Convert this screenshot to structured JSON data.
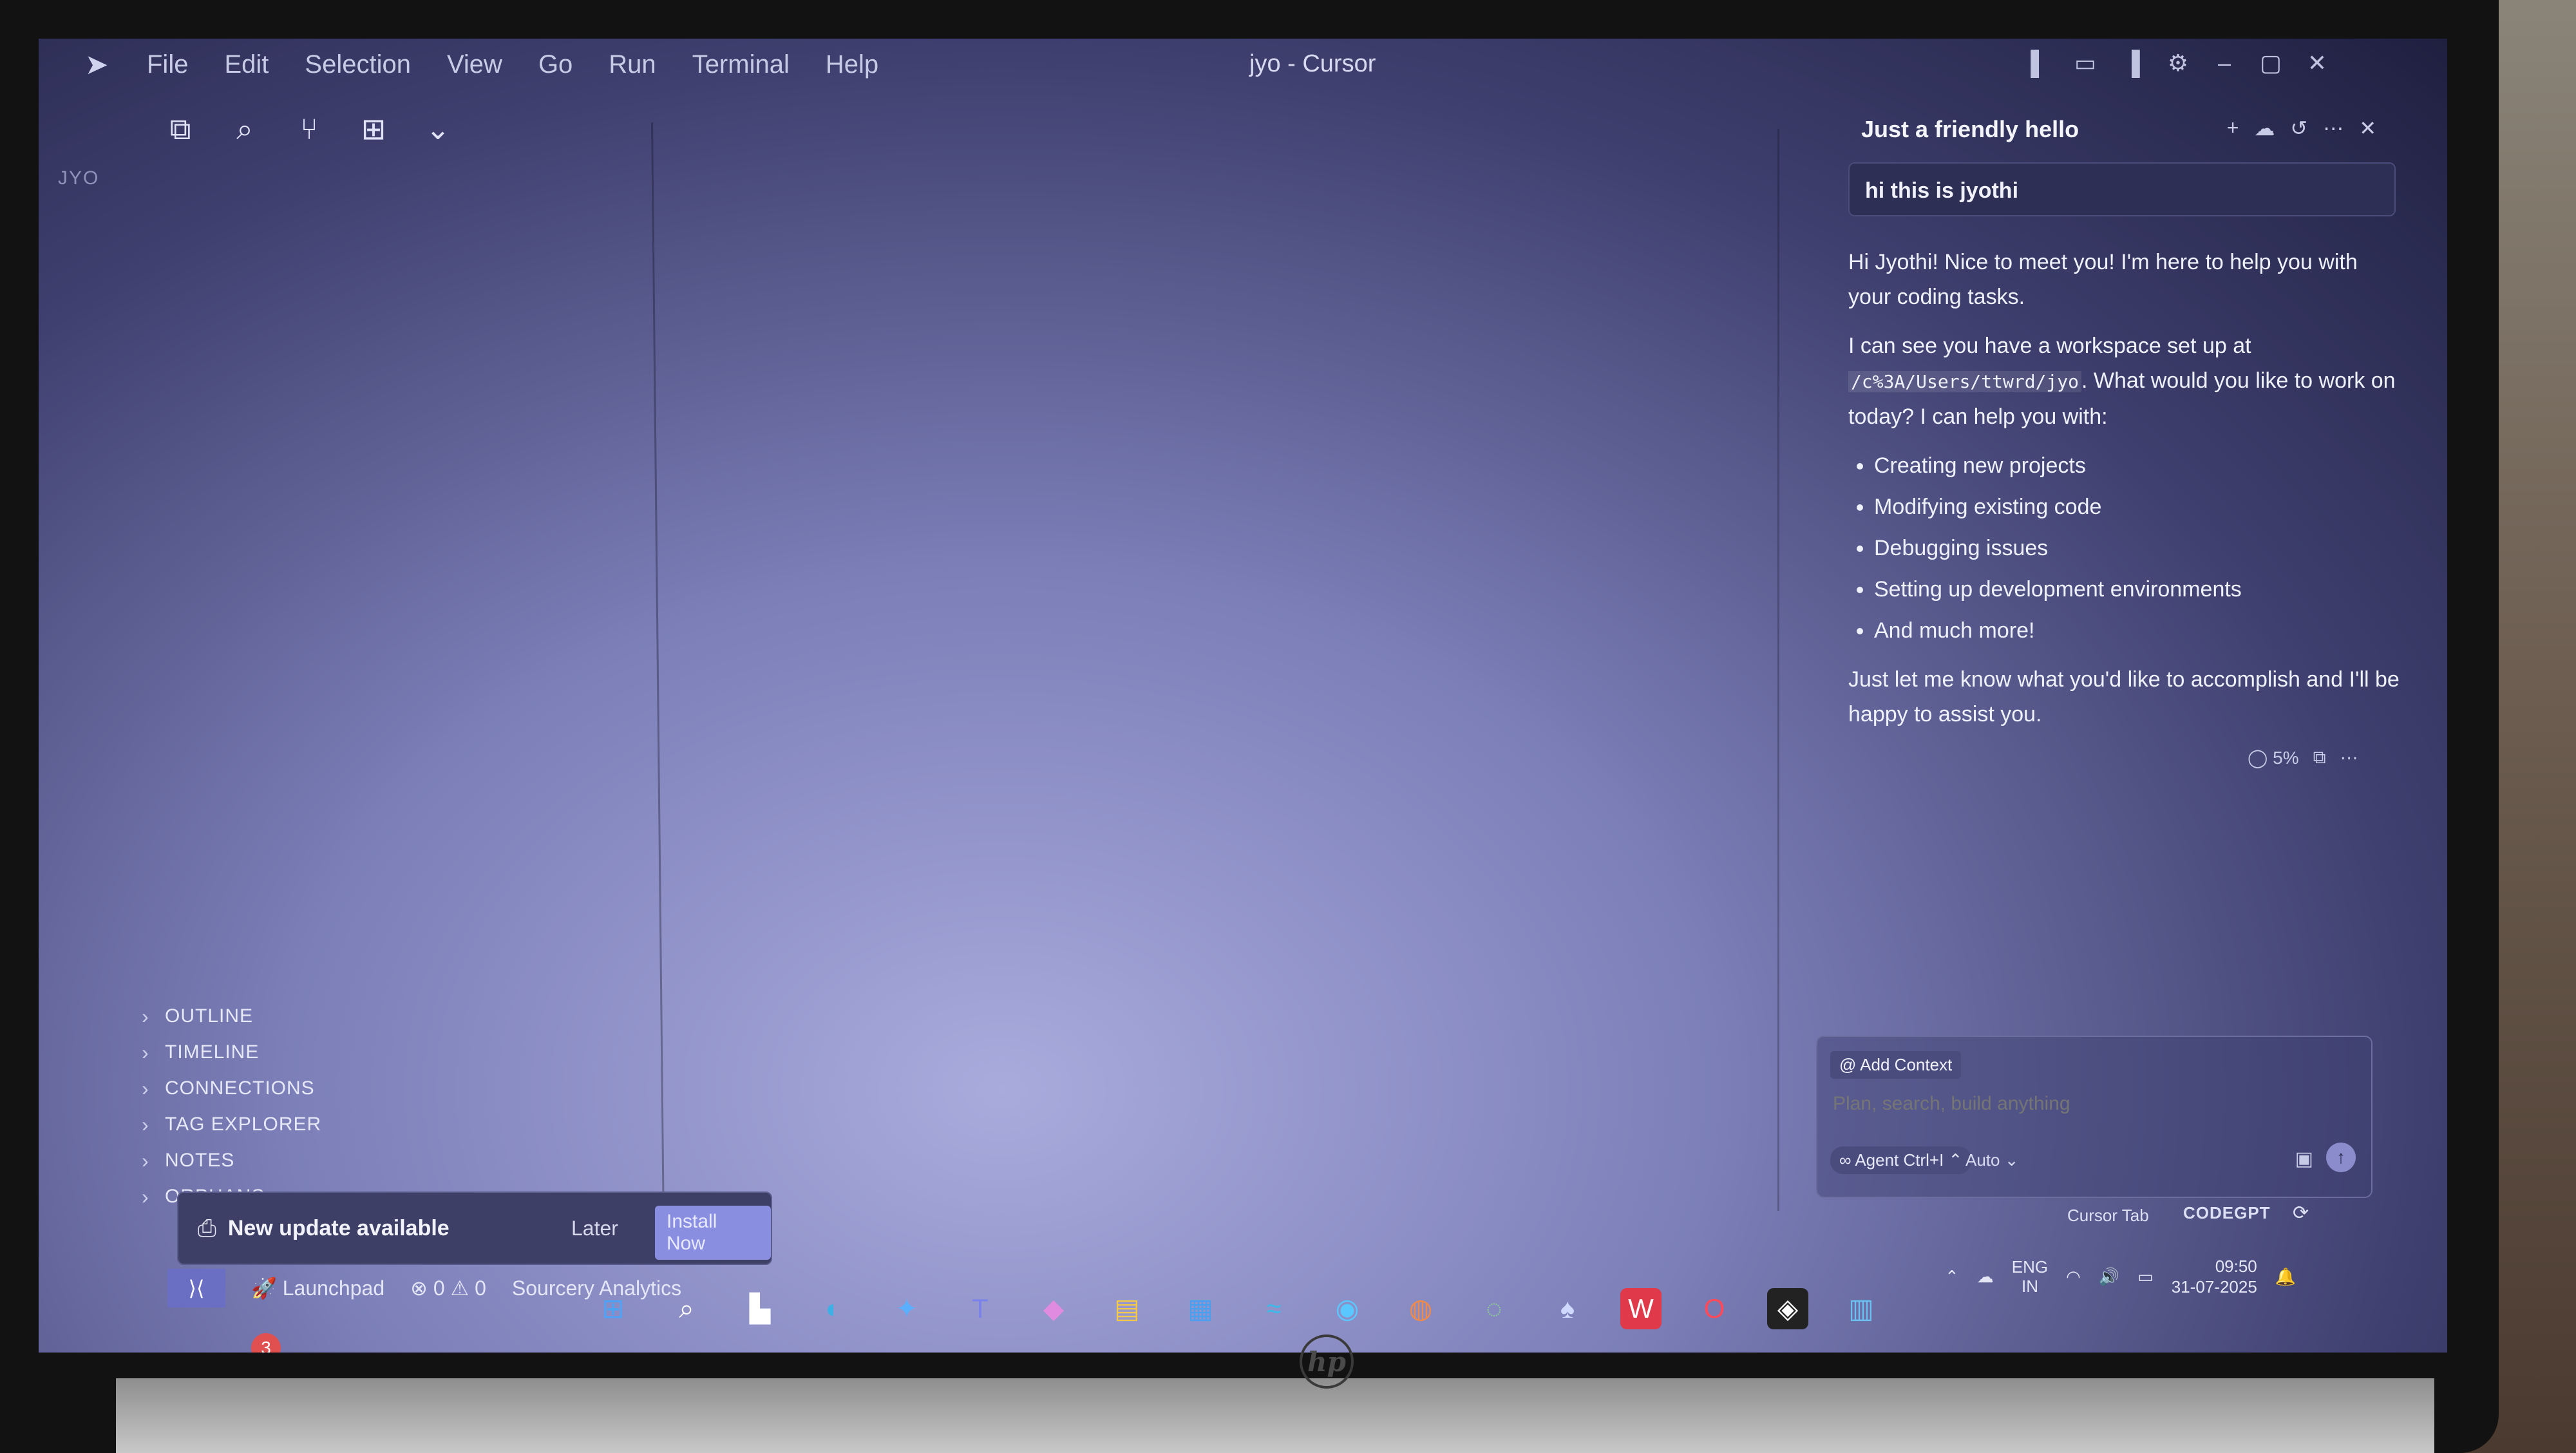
{
  "window": {
    "title": "jyo - Cursor",
    "workspace_label": "JYO"
  },
  "menu": [
    "File",
    "Edit",
    "Selection",
    "View",
    "Go",
    "Run",
    "Terminal",
    "Help"
  ],
  "toolbar_icons": [
    "explorer-icon",
    "search-icon",
    "source-control-icon",
    "extensions-icon",
    "chevron-down-icon"
  ],
  "sidebar": {
    "sections": [
      "OUTLINE",
      "TIMELINE",
      "CONNECTIONS",
      "TAG EXPLORER",
      "NOTES",
      "ORPHANS"
    ]
  },
  "update_toast": {
    "message": "New update available",
    "later": "Later",
    "install": "Install Now"
  },
  "statusbar": {
    "remote": "⟩⟨",
    "launchpad": "Launchpad",
    "problems": "⊗ 0 ⚠ 0",
    "analytics": "Sourcery Analytics"
  },
  "chat": {
    "title": "Just a friendly hello",
    "user_message": "hi this is jyothi",
    "greeting": "Hi Jyothi! Nice to meet you! I'm here to help you with your coding tasks.",
    "workspace_prefix": "I can see you have a workspace set up at",
    "workspace_path": "/c%3A/Users/ttwrd/jyo",
    "workspace_suffix": ". What would you like to work on today? I can help you with:",
    "help_items": [
      "Creating new projects",
      "Modifying existing code",
      "Debugging issues",
      "Setting up development environments",
      "And much more!"
    ],
    "closing": "Just let me know what you'd like to accomplish and I'll be happy to assist you.",
    "meta_percent": "5%"
  },
  "composer": {
    "add_context": "@ Add Context",
    "placeholder": "Plan, search, build anything",
    "agent": "∞ Agent Ctrl+I ⌃",
    "model": "Auto ⌄"
  },
  "footer_bar": {
    "cursor_tab": "Cursor Tab",
    "codegpt": "CODEGPT"
  },
  "taskbar": {
    "lang_top": "ENG",
    "lang_bottom": "IN",
    "time": "09:50",
    "date": "31-07-2025",
    "notification_count": "3"
  },
  "colors": {
    "accent": "#6b6fc4",
    "panel": "#2e2f55",
    "text": "#eef0fa"
  }
}
